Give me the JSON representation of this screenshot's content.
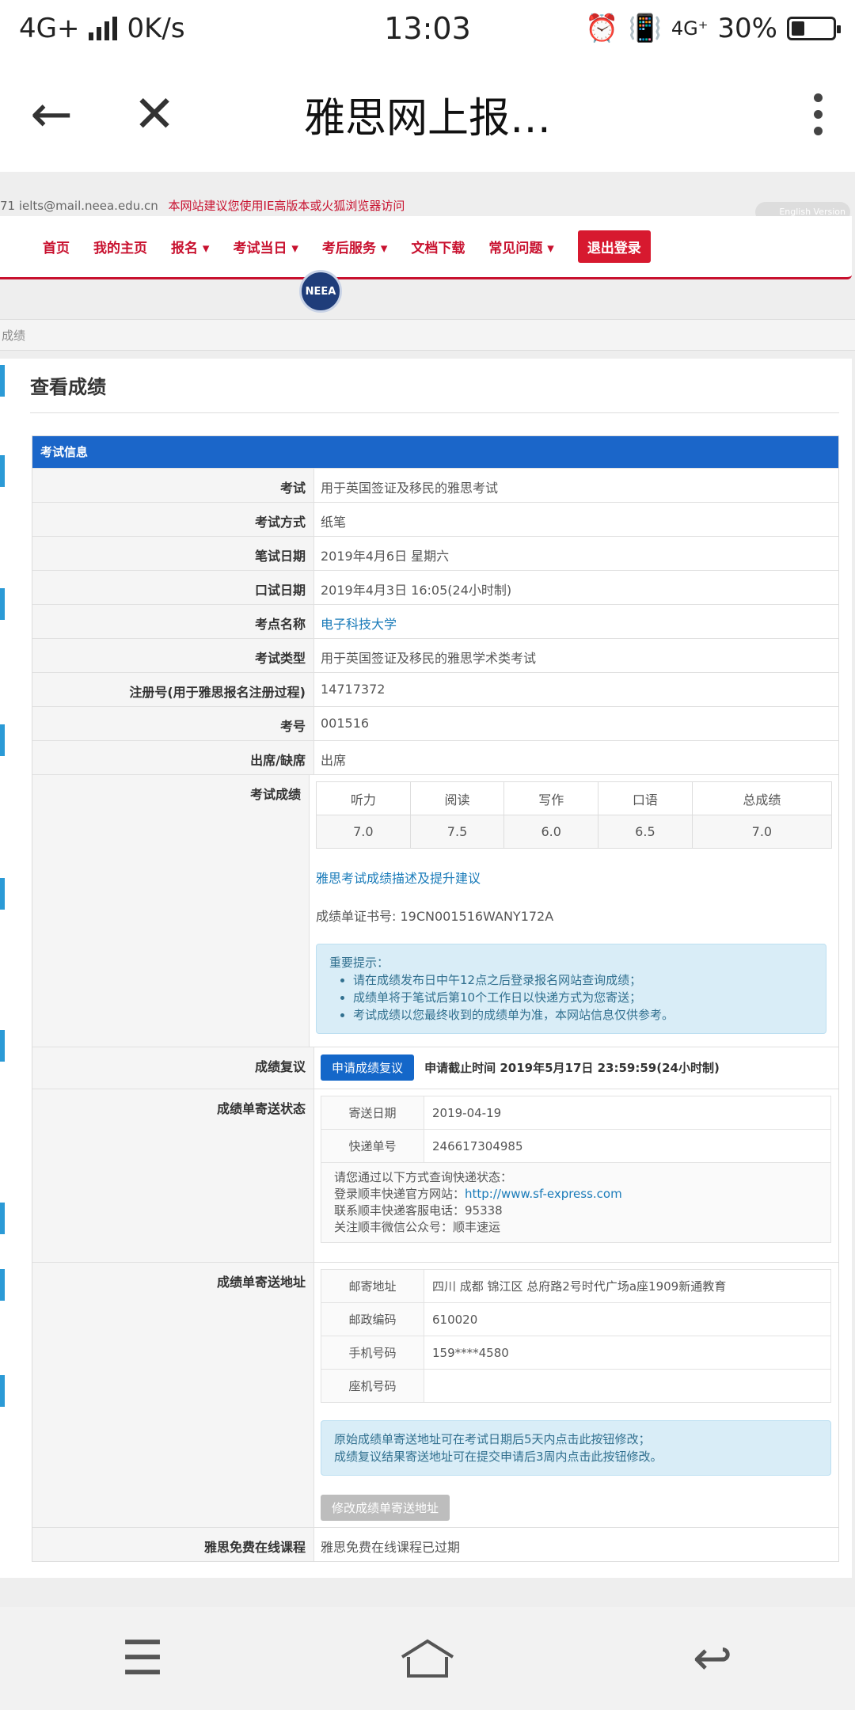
{
  "status_bar": {
    "network": "4G+",
    "speed": "0K/s",
    "time": "13:03",
    "net2": "4G⁺",
    "battery": "30%",
    "icons": [
      "signal-icon",
      "alarm-icon",
      "vibrate-icon",
      "battery-icon"
    ]
  },
  "browser": {
    "title": "雅思网上报…",
    "back_icon": "←",
    "close_icon": "✕"
  },
  "site": {
    "top_email": "71  ielts@mail.neea.edu.cn",
    "top_notice": "本网站建议您使用IE高版本或火狐浏览器访问",
    "english_version": "English Version",
    "logo_text": "NEEA",
    "menu": [
      {
        "label": "首页"
      },
      {
        "label": "我的主页"
      },
      {
        "label": "报名 ▾"
      },
      {
        "label": "考试当日 ▾"
      },
      {
        "label": "考后服务 ▾"
      },
      {
        "label": "文档下载"
      },
      {
        "label": "常见问题 ▾"
      }
    ],
    "logout": "退出登录",
    "breadcrumb": "成绩"
  },
  "page": {
    "title": "查看成绩",
    "section": "考试信息",
    "rows": [
      {
        "label": "考试",
        "value": "用于英国签证及移民的雅思考试"
      },
      {
        "label": "考试方式",
        "value": "纸笔"
      },
      {
        "label": "笔试日期",
        "value": "2019年4月6日 星期六"
      },
      {
        "label": "口试日期",
        "value": "2019年4月3日 16:05(24小时制)"
      },
      {
        "label": "考点名称",
        "value": "电子科技大学"
      },
      {
        "label": "考试类型",
        "value": "用于英国签证及移民的雅思学术类考试"
      },
      {
        "label": "注册号(用于雅思报名注册过程)",
        "value": "14717372"
      },
      {
        "label": "考号",
        "value": "001516"
      },
      {
        "label": "出席/缺席",
        "value": "出席"
      }
    ],
    "score_label": "考试成绩",
    "score_headers": [
      "听力",
      "阅读",
      "写作",
      "口语",
      "总成绩"
    ],
    "score_values": [
      "7.0",
      "7.5",
      "6.0",
      "6.5",
      "7.0"
    ],
    "score_link": "雅思考试成绩描述及提升建议",
    "certificate": "成绩单证书号: 19CN001516WANY172A",
    "tip_title": "重要提示：",
    "tips": [
      "请在成绩发布日中午12点之后登录报名网站查询成绩；",
      "成绩单将于笔试后第10个工作日以快递方式为您寄送；",
      "考试成绩以您最终收到的成绩单为准，本网站信息仅供参考。"
    ],
    "review_label": "成绩复议",
    "review_button": "申请成绩复议",
    "review_deadline": "申请截止时间 2019年5月17日 23:59:59(24小时制)",
    "mail_status_label": "成绩单寄送状态",
    "mail_status": [
      {
        "key": "寄送日期",
        "value": "2019-04-19"
      },
      {
        "key": "快递单号",
        "value": "246617304985"
      }
    ],
    "express_note": [
      "请您通过以下方式查询快递状态：",
      "登录顺丰快递官方网站：",
      "联系顺丰快递客服电话：95338",
      "关注顺丰微信公众号：顺丰速运"
    ],
    "express_url": "http://www.sf-express.com",
    "address_label": "成绩单寄送地址",
    "address": [
      {
        "key": "邮寄地址",
        "value": "四川 成都 锦江区 总府路2号时代广场a座1909新通教育"
      },
      {
        "key": "邮政编码",
        "value": "610020"
      },
      {
        "key": "手机号码",
        "value": "159****4580"
      },
      {
        "key": "座机号码",
        "value": ""
      }
    ],
    "address_tip": [
      "原始成绩单寄送地址可在考试日期后5天内点击此按钮修改；",
      "成绩复议结果寄送地址可在提交申请后3周内点击此按钮修改。"
    ],
    "modify_button": "修改成绩单寄送地址",
    "course_label": "雅思免费在线课程",
    "course_value": "雅思免费在线课程已过期"
  }
}
